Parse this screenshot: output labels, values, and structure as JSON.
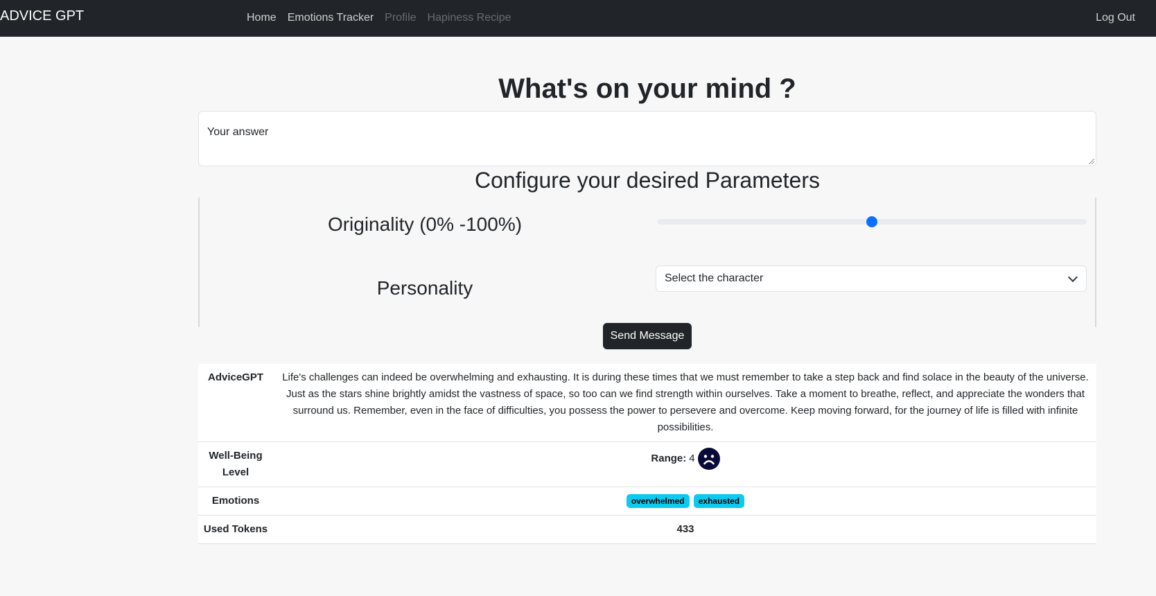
{
  "navbar": {
    "brand": "ADVICE GPT",
    "links": [
      {
        "label": "Home"
      },
      {
        "label": "Emotions Tracker"
      },
      {
        "label": "Profile"
      },
      {
        "label": "Hapiness Recipe"
      }
    ],
    "logout": "Log Out"
  },
  "main": {
    "title": "What's on your mind ?",
    "answer_value": "Your answer",
    "params_title": "Configure your desired Parameters",
    "originality_label": "Originality (0% -100%)",
    "originality_value": 0.5,
    "personality_label": "Personality",
    "personality_selected": "Select the character",
    "send_button": "Send Message"
  },
  "results": {
    "advice_label": "AdviceGPT",
    "advice_text": "Life's challenges can indeed be overwhelming and exhausting. It is during these times that we must remember to take a step back and find solace in the beauty of the universe. Just as the stars shine brightly amidst the vastness of space, so too can we find strength within ourselves. Take a moment to breathe, reflect, and appreciate the wonders that surround us. Remember, even in the face of difficulties, you possess the power to persevere and overcome. Keep moving forward, for the journey of life is filled with infinite possibilities.",
    "wellbeing_label": "Well-Being Level",
    "range_label": "Range:",
    "range_value": "4",
    "mood_icon": "sad-face-icon",
    "emotions_label": "Emotions",
    "emotions": [
      "overwhelmed",
      "exhausted"
    ],
    "tokens_label": "Used Tokens",
    "tokens_value": "433"
  },
  "colors": {
    "navbar": "#212529",
    "accent": "#0d6efd",
    "badge": "#0dcaf0",
    "mood_icon": "#0a0a3a"
  }
}
